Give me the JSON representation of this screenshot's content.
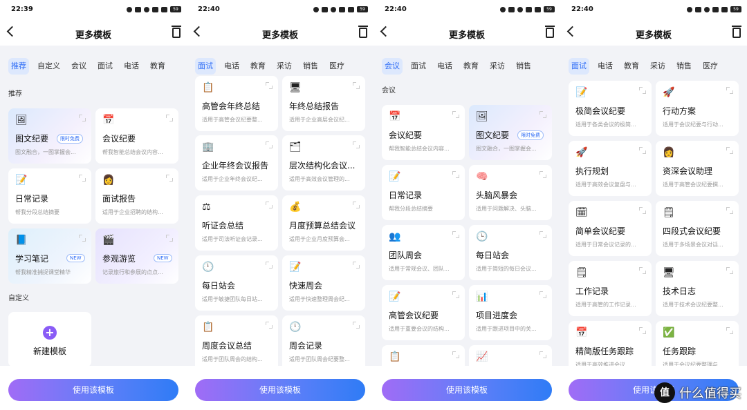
{
  "common": {
    "title": "更多模板",
    "use_button": "使用该模板",
    "battery": "59"
  },
  "panels": [
    {
      "time": "22:39",
      "tabs": [
        "推荐",
        "自定义",
        "会议",
        "面试",
        "电话",
        "教育"
      ],
      "active_tab": 0,
      "sections": [
        "推荐",
        "自定义"
      ],
      "cards": [
        {
          "icon": "🖼",
          "title": "图文纪要",
          "desc": "图文融合，一图掌握会...",
          "badge": "限时免费"
        },
        {
          "icon": "📅",
          "title": "会议纪要",
          "desc": "帮我智能总结会议内容..."
        },
        {
          "icon": "📝",
          "title": "日常记录",
          "desc": "帮我分段总结摘要"
        },
        {
          "icon": "👩",
          "title": "面试报告",
          "desc": "适用于企业招聘的结构..."
        },
        {
          "icon": "📘",
          "title": "学习笔记",
          "desc": "帮我精准捕捉课堂精华",
          "badge": "NEW"
        },
        {
          "icon": "🎬",
          "title": "参观游览",
          "desc": "记录旅行和参展的点点...",
          "badge": "NEW"
        }
      ],
      "new_template": "新建模板"
    },
    {
      "time": "22:40",
      "tabs": [
        "面试",
        "电话",
        "教育",
        "采访",
        "销售",
        "医疗"
      ],
      "active_tab": 0,
      "cards": [
        {
          "icon": "📋",
          "title": "高管会年终总结",
          "desc": "适用于高管会议纪要整..."
        },
        {
          "icon": "🖥",
          "title": "年终总结报告",
          "desc": "适用于企业高层会议纪..."
        },
        {
          "icon": "🏢",
          "title": "企业年终会议报告",
          "desc": "适用于企业年终会议纪..."
        },
        {
          "icon": "🗂",
          "title": "层次结构化会议...",
          "desc": "适用于高效会议管理的..."
        },
        {
          "icon": "⚖",
          "title": "听证会总结",
          "desc": "适用于司法听证会记录..."
        },
        {
          "icon": "💰",
          "title": "月度预算总结会议",
          "desc": "适用于企业月度预算会..."
        },
        {
          "icon": "🕛",
          "title": "每日站会",
          "desc": "适用于敏捷团队每日站..."
        },
        {
          "icon": "📝",
          "title": "快速周会",
          "desc": "适用于快速整理周会纪..."
        },
        {
          "icon": "📋",
          "title": "周度会议总结",
          "desc": "适用于团队周会的结构..."
        },
        {
          "icon": "🕛",
          "title": "周会记录",
          "desc": "适用于团队周会纪要整..."
        }
      ]
    },
    {
      "time": "22:40",
      "tabs": [
        "会议",
        "面试",
        "电话",
        "教育",
        "采访",
        "销售"
      ],
      "active_tab": 0,
      "sections": [
        "会议"
      ],
      "cards": [
        {
          "icon": "📅",
          "title": "会议纪要",
          "desc": "帮我智能总结会议内容..."
        },
        {
          "icon": "🖼",
          "title": "图文纪要",
          "desc": "图文融合，一图掌握会...",
          "badge": "限时免费"
        },
        {
          "icon": "📝",
          "title": "日常记录",
          "desc": "帮我分段总结摘要"
        },
        {
          "icon": "🧠",
          "title": "头脑风暴会",
          "desc": "适用于问题解决、头脑..."
        },
        {
          "icon": "👥",
          "title": "团队周会",
          "desc": "适用于常规会议、团队..."
        },
        {
          "icon": "🕒",
          "title": "每日站会",
          "desc": "适用于简短的每日会议..."
        },
        {
          "icon": "📝",
          "title": "高管会议纪要",
          "desc": "适用于重要会议的结构..."
        },
        {
          "icon": "📊",
          "title": "项目进度会",
          "desc": "适用于跟进项目中的关..."
        },
        {
          "icon": "📋",
          "title": "",
          "desc": ""
        },
        {
          "icon": "📈",
          "title": "",
          "desc": ""
        }
      ]
    },
    {
      "time": "22:40",
      "tabs": [
        "面试",
        "电话",
        "教育",
        "采访",
        "销售",
        "医疗"
      ],
      "active_tab": 0,
      "cards": [
        {
          "icon": "📝",
          "title": "极简会议纪要",
          "desc": "适用于各类会议的极简..."
        },
        {
          "icon": "🚀",
          "title": "行动方案",
          "desc": "适用于会议纪要与行动..."
        },
        {
          "icon": "🚀",
          "title": "执行规划",
          "desc": "适用于高效会议复盘与..."
        },
        {
          "icon": "👩",
          "title": "资深会议助理",
          "desc": "适用于高管会议纪要撰..."
        },
        {
          "icon": "🗓",
          "title": "简单会议纪要",
          "desc": "适用于日常会议记录的..."
        },
        {
          "icon": "🗒",
          "title": "四段式会议纪要",
          "desc": "适用于多场景会议对话..."
        },
        {
          "icon": "🗒",
          "title": "工作记录",
          "desc": "适用于高管的工作记录..."
        },
        {
          "icon": "🖥",
          "title": "技术日志",
          "desc": "适用于技术会议纪要整..."
        },
        {
          "icon": "📅",
          "title": "精简版任务跟踪",
          "desc": "适用于高效推进会议..."
        },
        {
          "icon": "✅",
          "title": "任务跟踪",
          "desc": "适用于会议纪要整理与..."
        }
      ]
    }
  ],
  "watermark": {
    "logo": "值",
    "text": "什么值得买"
  }
}
